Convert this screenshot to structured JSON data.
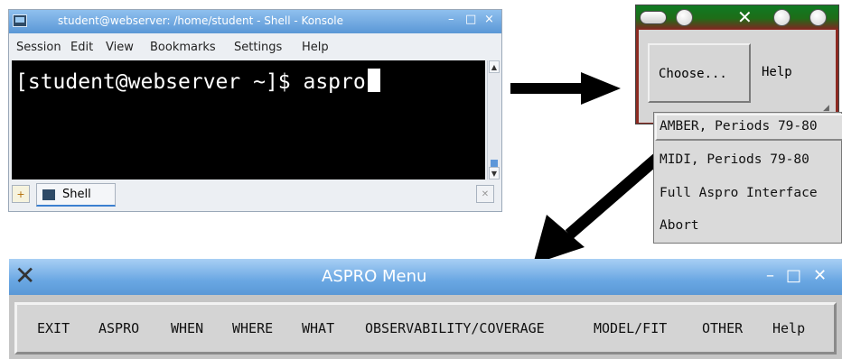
{
  "konsole": {
    "title": "student@webserver: /home/student - Shell - Konsole",
    "title_buttons": [
      "–",
      "□",
      "×"
    ],
    "menu": [
      "Session",
      "Edit",
      "View",
      "Bookmarks",
      "Settings",
      "Help"
    ],
    "prompt": "[student@webserver ~]$ aspro",
    "tab_label": "Shell",
    "scroll_up": "▲",
    "scroll_down": "▼"
  },
  "tk_window": {
    "choose_label": "Choose...",
    "help_label": "Help",
    "dropdown_items": [
      "AMBER, Periods 79-80",
      "MIDI, Periods 79-80",
      "Full Aspro Interface",
      "Abort"
    ]
  },
  "aspro_menu": {
    "title": "ASPRO Menu",
    "title_buttons": [
      "–",
      "□",
      "✕"
    ],
    "items": [
      "EXIT",
      "ASPRO",
      "WHEN",
      "WHERE",
      "WHAT",
      "OBSERVABILITY/COVERAGE",
      "MODEL/FIT",
      "OTHER",
      "Help"
    ]
  },
  "colors": {
    "titlebar_blue": "#5a97d6",
    "terminal_bg": "#000000",
    "tk_title_green": "#0f7a23",
    "tk_frame_red": "#8c2a22",
    "arrow": "#000000"
  }
}
